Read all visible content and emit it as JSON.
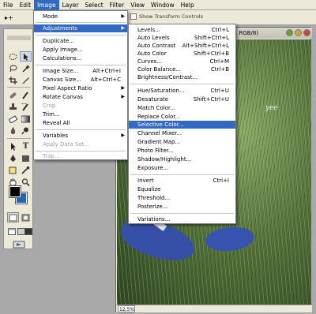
{
  "menubar": {
    "items": [
      "File",
      "Edit",
      "Image",
      "Layer",
      "Select",
      "Filter",
      "View",
      "Window",
      "Help"
    ],
    "active_index": 2
  },
  "options_bar": {
    "tool_preset": "▸+",
    "show_transform_controls": "Show Transform Controls"
  },
  "document": {
    "title": "…, RGB/8)",
    "watermark": "yee",
    "zoom": "12,5%"
  },
  "colors": {
    "foreground": "#000000",
    "background": "#1f66b5",
    "menu_highlight": "#316ac5"
  },
  "image_menu": {
    "items": [
      {
        "label": "Mode",
        "submenu": true
      },
      {
        "label": "Adjustments",
        "submenu": true,
        "highlighted": true
      },
      {
        "label": "Duplicate..."
      },
      {
        "label": "Apply Image..."
      },
      {
        "label": "Calculations..."
      },
      {
        "label": "Image Size...",
        "shortcut": "Alt+Ctrl+I"
      },
      {
        "label": "Canvas Size...",
        "shortcut": "Alt+Ctrl+C"
      },
      {
        "label": "Pixel Aspect Ratio",
        "submenu": true
      },
      {
        "label": "Rotate Canvas",
        "submenu": true
      },
      {
        "label": "Crop",
        "disabled": true
      },
      {
        "label": "Trim..."
      },
      {
        "label": "Reveal All"
      },
      {
        "label": "Variables",
        "submenu": true
      },
      {
        "label": "Apply Data Set...",
        "disabled": true
      },
      {
        "label": "Trap...",
        "disabled": true
      }
    ]
  },
  "adjustments_menu": {
    "items": [
      {
        "label": "Levels...",
        "shortcut": "Ctrl+L"
      },
      {
        "label": "Auto Levels",
        "shortcut": "Shift+Ctrl+L"
      },
      {
        "label": "Auto Contrast",
        "shortcut": "Alt+Shift+Ctrl+L"
      },
      {
        "label": "Auto Color",
        "shortcut": "Shift+Ctrl+B"
      },
      {
        "label": "Curves...",
        "shortcut": "Ctrl+M"
      },
      {
        "label": "Color Balance...",
        "shortcut": "Ctrl+B"
      },
      {
        "label": "Brightness/Contrast..."
      },
      {
        "label": "Hue/Saturation...",
        "shortcut": "Ctrl+U"
      },
      {
        "label": "Desaturate",
        "shortcut": "Shift+Ctrl+U"
      },
      {
        "label": "Match Color..."
      },
      {
        "label": "Replace Color..."
      },
      {
        "label": "Selective Color...",
        "highlighted": true
      },
      {
        "label": "Channel Mixer..."
      },
      {
        "label": "Gradient Map..."
      },
      {
        "label": "Photo Filter..."
      },
      {
        "label": "Shadow/Highlight..."
      },
      {
        "label": "Exposure..."
      },
      {
        "label": "Invert",
        "shortcut": "Ctrl+I"
      },
      {
        "label": "Equalize"
      },
      {
        "label": "Threshold..."
      },
      {
        "label": "Posterize..."
      },
      {
        "label": "Variations..."
      }
    ]
  },
  "toolbox": {
    "tools": [
      "move-tool",
      "marquee-tool",
      "lasso-tool",
      "magic-wand-tool",
      "crop-tool",
      "slice-tool",
      "healing-brush-tool",
      "brush-tool",
      "clone-stamp-tool",
      "history-brush-tool",
      "eraser-tool",
      "gradient-tool",
      "blur-tool",
      "dodge-tool",
      "path-selection-tool",
      "type-tool",
      "pen-tool",
      "shape-tool",
      "notes-tool",
      "eyedropper-tool",
      "hand-tool",
      "zoom-tool"
    ]
  }
}
